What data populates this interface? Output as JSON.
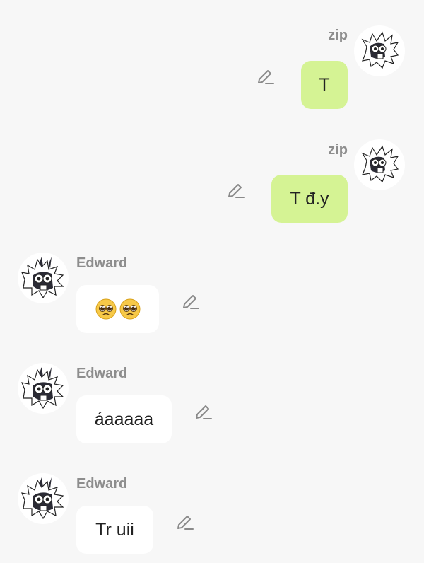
{
  "messages": [
    {
      "sender": "zip",
      "text": "T",
      "side": "right"
    },
    {
      "sender": "zip",
      "text": "T đ.y",
      "side": "right"
    },
    {
      "sender": "Edward",
      "text": "",
      "emoji": "pleading-face-emoji",
      "emoji_count": 2,
      "side": "left"
    },
    {
      "sender": "Edward",
      "text": "áaaaaa",
      "side": "left"
    },
    {
      "sender": "Edward",
      "text": "Tr uii",
      "side": "left"
    }
  ],
  "colors": {
    "background": "#f7f7f7",
    "my_bubble": "#d5f394",
    "their_bubble": "#ffffff",
    "sender_label": "#8d8d8d",
    "edit_icon": "#8a8a8a"
  },
  "icons": {
    "edit": "pencil-icon",
    "avatar": "cartoon-creature-avatar"
  }
}
